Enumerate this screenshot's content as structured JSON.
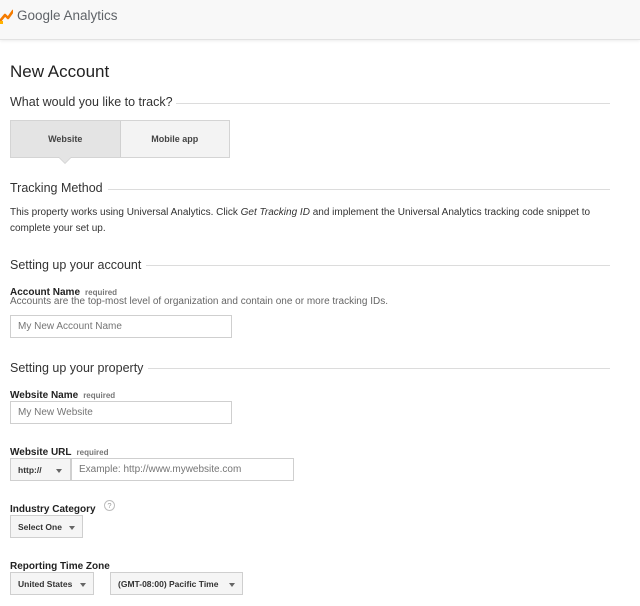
{
  "header": {
    "brand": "Google Analytics"
  },
  "page_title": "New Account",
  "track": {
    "heading": "What would you like to track?",
    "options": [
      {
        "label": "Website",
        "selected": true
      },
      {
        "label": "Mobile app",
        "selected": false
      }
    ]
  },
  "tracking_method": {
    "heading": "Tracking Method",
    "text_before": "This property works using Universal Analytics. Click ",
    "text_italic": "Get Tracking ID",
    "text_after": " and implement the Universal Analytics tracking code snippet to complete your set up."
  },
  "account": {
    "heading": "Setting up your account",
    "name_label": "Account Name",
    "required": "required",
    "help_text": "Accounts are the top-most level of organization and contain one or more tracking IDs.",
    "name_placeholder": "My New Account Name"
  },
  "property": {
    "heading": "Setting up your property",
    "website_name_label": "Website Name",
    "website_name_placeholder": "My New Website",
    "website_url_label": "Website URL",
    "protocol": "http://",
    "url_placeholder": "Example: http://www.mywebsite.com",
    "industry_label": "Industry Category",
    "industry_value": "Select One",
    "help_icon": "?",
    "timezone_label": "Reporting Time Zone",
    "country_value": "United States",
    "timezone_value": "(GMT-08:00) Pacific Time"
  },
  "colors": {
    "logo_orange": "#f57c00",
    "logo_yellow": "#ffb300"
  }
}
